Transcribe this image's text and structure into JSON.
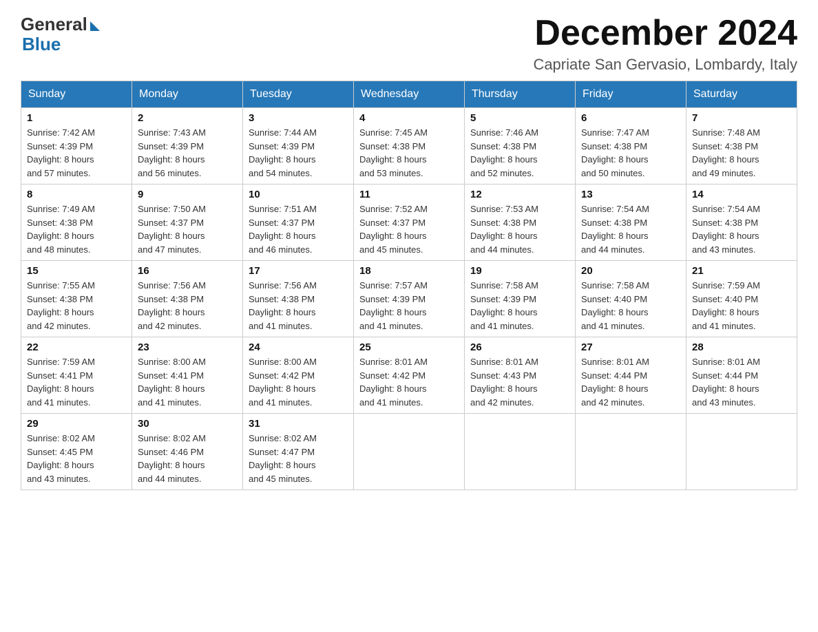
{
  "header": {
    "logo_general": "General",
    "logo_blue": "Blue",
    "month_title": "December 2024",
    "location": "Capriate San Gervasio, Lombardy, Italy"
  },
  "weekdays": [
    "Sunday",
    "Monday",
    "Tuesday",
    "Wednesday",
    "Thursday",
    "Friday",
    "Saturday"
  ],
  "weeks": [
    [
      {
        "day": "1",
        "sunrise": "7:42 AM",
        "sunset": "4:39 PM",
        "daylight": "8 hours and 57 minutes."
      },
      {
        "day": "2",
        "sunrise": "7:43 AM",
        "sunset": "4:39 PM",
        "daylight": "8 hours and 56 minutes."
      },
      {
        "day": "3",
        "sunrise": "7:44 AM",
        "sunset": "4:39 PM",
        "daylight": "8 hours and 54 minutes."
      },
      {
        "day": "4",
        "sunrise": "7:45 AM",
        "sunset": "4:38 PM",
        "daylight": "8 hours and 53 minutes."
      },
      {
        "day": "5",
        "sunrise": "7:46 AM",
        "sunset": "4:38 PM",
        "daylight": "8 hours and 52 minutes."
      },
      {
        "day": "6",
        "sunrise": "7:47 AM",
        "sunset": "4:38 PM",
        "daylight": "8 hours and 50 minutes."
      },
      {
        "day": "7",
        "sunrise": "7:48 AM",
        "sunset": "4:38 PM",
        "daylight": "8 hours and 49 minutes."
      }
    ],
    [
      {
        "day": "8",
        "sunrise": "7:49 AM",
        "sunset": "4:38 PM",
        "daylight": "8 hours and 48 minutes."
      },
      {
        "day": "9",
        "sunrise": "7:50 AM",
        "sunset": "4:37 PM",
        "daylight": "8 hours and 47 minutes."
      },
      {
        "day": "10",
        "sunrise": "7:51 AM",
        "sunset": "4:37 PM",
        "daylight": "8 hours and 46 minutes."
      },
      {
        "day": "11",
        "sunrise": "7:52 AM",
        "sunset": "4:37 PM",
        "daylight": "8 hours and 45 minutes."
      },
      {
        "day": "12",
        "sunrise": "7:53 AM",
        "sunset": "4:38 PM",
        "daylight": "8 hours and 44 minutes."
      },
      {
        "day": "13",
        "sunrise": "7:54 AM",
        "sunset": "4:38 PM",
        "daylight": "8 hours and 44 minutes."
      },
      {
        "day": "14",
        "sunrise": "7:54 AM",
        "sunset": "4:38 PM",
        "daylight": "8 hours and 43 minutes."
      }
    ],
    [
      {
        "day": "15",
        "sunrise": "7:55 AM",
        "sunset": "4:38 PM",
        "daylight": "8 hours and 42 minutes."
      },
      {
        "day": "16",
        "sunrise": "7:56 AM",
        "sunset": "4:38 PM",
        "daylight": "8 hours and 42 minutes."
      },
      {
        "day": "17",
        "sunrise": "7:56 AM",
        "sunset": "4:38 PM",
        "daylight": "8 hours and 41 minutes."
      },
      {
        "day": "18",
        "sunrise": "7:57 AM",
        "sunset": "4:39 PM",
        "daylight": "8 hours and 41 minutes."
      },
      {
        "day": "19",
        "sunrise": "7:58 AM",
        "sunset": "4:39 PM",
        "daylight": "8 hours and 41 minutes."
      },
      {
        "day": "20",
        "sunrise": "7:58 AM",
        "sunset": "4:40 PM",
        "daylight": "8 hours and 41 minutes."
      },
      {
        "day": "21",
        "sunrise": "7:59 AM",
        "sunset": "4:40 PM",
        "daylight": "8 hours and 41 minutes."
      }
    ],
    [
      {
        "day": "22",
        "sunrise": "7:59 AM",
        "sunset": "4:41 PM",
        "daylight": "8 hours and 41 minutes."
      },
      {
        "day": "23",
        "sunrise": "8:00 AM",
        "sunset": "4:41 PM",
        "daylight": "8 hours and 41 minutes."
      },
      {
        "day": "24",
        "sunrise": "8:00 AM",
        "sunset": "4:42 PM",
        "daylight": "8 hours and 41 minutes."
      },
      {
        "day": "25",
        "sunrise": "8:01 AM",
        "sunset": "4:42 PM",
        "daylight": "8 hours and 41 minutes."
      },
      {
        "day": "26",
        "sunrise": "8:01 AM",
        "sunset": "4:43 PM",
        "daylight": "8 hours and 42 minutes."
      },
      {
        "day": "27",
        "sunrise": "8:01 AM",
        "sunset": "4:44 PM",
        "daylight": "8 hours and 42 minutes."
      },
      {
        "day": "28",
        "sunrise": "8:01 AM",
        "sunset": "4:44 PM",
        "daylight": "8 hours and 43 minutes."
      }
    ],
    [
      {
        "day": "29",
        "sunrise": "8:02 AM",
        "sunset": "4:45 PM",
        "daylight": "8 hours and 43 minutes."
      },
      {
        "day": "30",
        "sunrise": "8:02 AM",
        "sunset": "4:46 PM",
        "daylight": "8 hours and 44 minutes."
      },
      {
        "day": "31",
        "sunrise": "8:02 AM",
        "sunset": "4:47 PM",
        "daylight": "8 hours and 45 minutes."
      },
      null,
      null,
      null,
      null
    ]
  ],
  "labels": {
    "sunrise": "Sunrise:",
    "sunset": "Sunset:",
    "daylight": "Daylight:"
  }
}
